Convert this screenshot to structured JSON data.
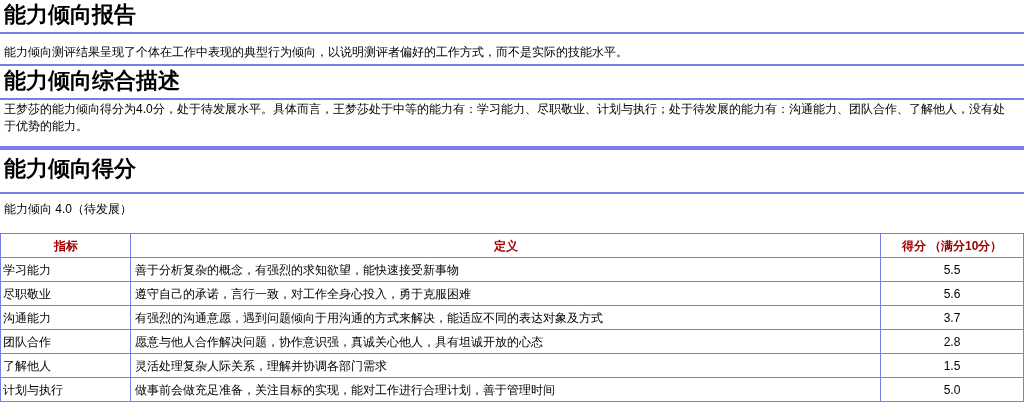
{
  "sections": [
    {
      "kind": "heading",
      "text": "能力倾向报告"
    },
    {
      "kind": "paragraph",
      "text": "能力倾向测评结果呈现了个体在工作中表现的典型行为倾向，以说明测评者偏好的工作方式，而不是实际的技能水平。"
    },
    {
      "kind": "heading",
      "text": "能力倾向综合描述"
    },
    {
      "kind": "paragraph",
      "text": "王梦莎的能力倾向得分为4.0分，处于待发展水平。具体而言，王梦莎处于中等的能力有：学习能力、尽职敬业、计划与执行；处于待发展的能力有：沟通能力、团队合作、了解他人，没有处于优势的能力。"
    },
    {
      "kind": "heading",
      "text": "能力倾向得分"
    },
    {
      "kind": "summary",
      "text": "能力倾向 4.0（待发展）"
    }
  ],
  "table": {
    "columns": [
      "指标",
      "定义",
      "得分 （满分10分）"
    ],
    "rows": [
      {
        "indicator": "学习能力",
        "definition": "善于分析复杂的概念，有强烈的求知欲望，能快速接受新事物",
        "score": "5.5"
      },
      {
        "indicator": "尽职敬业",
        "definition": "遵守自己的承诺，言行一致，对工作全身心投入，勇于克服困难",
        "score": "5.6"
      },
      {
        "indicator": "沟通能力",
        "definition": "有强烈的沟通意愿，遇到问题倾向于用沟通的方式来解决，能适应不同的表达对象及方式",
        "score": "3.7"
      },
      {
        "indicator": "团队合作",
        "definition": "愿意与他人合作解决问题，协作意识强，真诚关心他人，具有坦诚开放的心态",
        "score": "2.8"
      },
      {
        "indicator": "了解他人",
        "definition": "灵活处理复杂人际关系，理解并协调各部门需求",
        "score": "1.5"
      },
      {
        "indicator": "计划与执行",
        "definition": "做事前会做充足准备，关注目标的实现，能对工作进行合理计划，善于管理时间",
        "score": "5.0"
      }
    ]
  }
}
